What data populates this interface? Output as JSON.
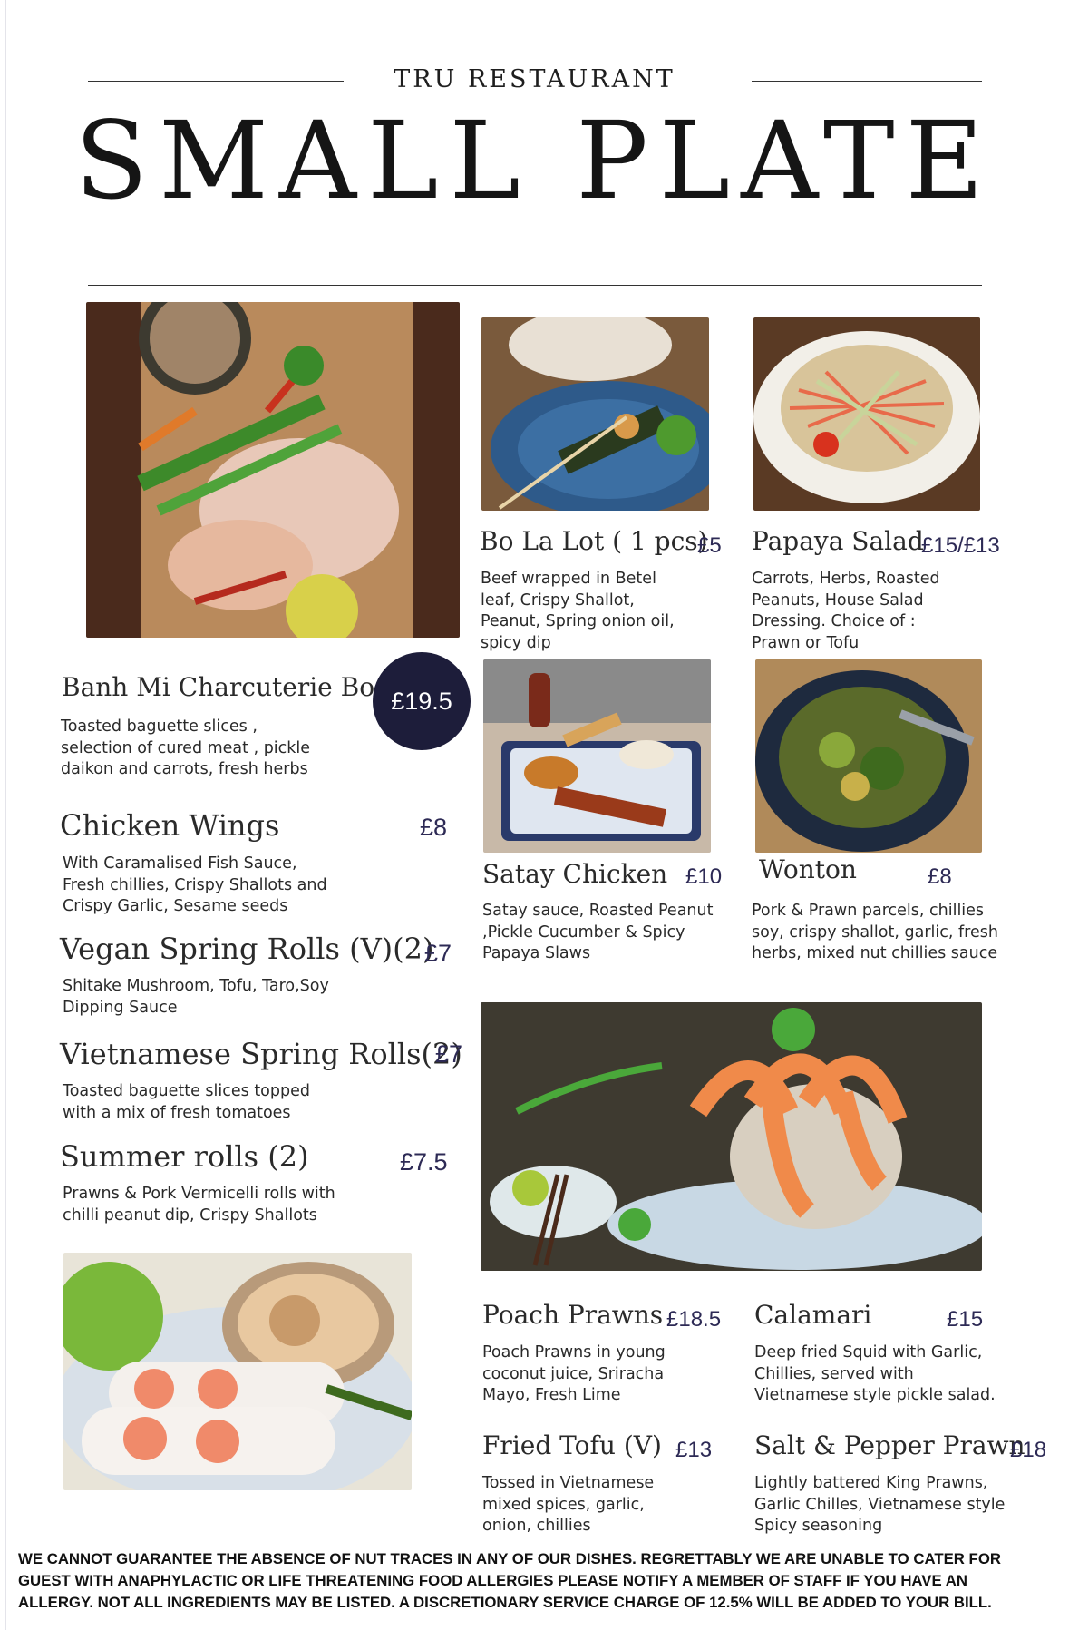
{
  "header": {
    "restaurant": "TRU RESTAURANT",
    "title": "SMALL PLATE"
  },
  "items": {
    "banh_mi": {
      "name": "Banh Mi Charcuterie Board",
      "price": "£19.5",
      "desc": [
        "Toasted baguette slices ,",
        "selection of cured meat , pickle",
        "daikon and carrots,  fresh herbs"
      ]
    },
    "bo_la_lot": {
      "name": "Bo La Lot ( 1 pcs)",
      "price": "£5",
      "desc": [
        "Beef wrapped in Betel",
        "leaf, Crispy Shallot,",
        "Peanut, Spring onion oil,",
        "spicy dip"
      ]
    },
    "papaya_salad": {
      "name": "Papaya Salad",
      "price": "£15/£13",
      "desc": [
        "Carrots, Herbs, Roasted",
        "Peanuts, House Salad",
        "Dressing. Choice of :",
        "Prawn or Tofu"
      ]
    },
    "chicken_wings": {
      "name": "Chicken Wings",
      "price": "£8",
      "desc": [
        "With Caramalised Fish Sauce,",
        "Fresh chillies, Crispy Shallots and",
        "Crispy Garlic, Sesame seeds"
      ]
    },
    "satay_chicken": {
      "name": "Satay Chicken",
      "price": "£10",
      "desc": [
        "Satay sauce, Roasted Peanut",
        ",Pickle Cucumber & Spicy",
        "Papaya Slaws"
      ]
    },
    "wonton": {
      "name": "Wonton",
      "price": "£8",
      "desc": [
        "Pork & Prawn parcels, chillies",
        "soy, crispy shallot, garlic, fresh",
        "herbs, mixed nut chillies sauce"
      ]
    },
    "vegan_spring_rolls": {
      "name": "Vegan Spring Rolls (V)(2)",
      "price": "£7",
      "desc": [
        "Shitake Mushroom, Tofu, Taro,Soy",
        "Dipping Sauce"
      ]
    },
    "vietnamese_spring_rolls": {
      "name": "Vietnamese Spring Rolls(2)",
      "price": "£7",
      "desc": [
        "Toasted baguette slices topped",
        "with a mix of fresh tomatoes"
      ]
    },
    "summer_rolls": {
      "name": "Summer rolls (2)",
      "price": "£7.5",
      "desc": [
        "Prawns & Pork Vermicelli rolls with",
        "chilli peanut dip, Crispy Shallots"
      ]
    },
    "poach_prawns": {
      "name": "Poach Prawns",
      "price": "£18.5",
      "desc": [
        "Poach Prawns in young",
        "coconut juice, Sriracha",
        "Mayo, Fresh Lime"
      ]
    },
    "calamari": {
      "name": "Calamari",
      "price": "£15",
      "desc": [
        "Deep fried Squid with Garlic,",
        "Chillies, served with",
        "Vietnamese style pickle salad."
      ]
    },
    "fried_tofu": {
      "name": "Fried Tofu (V)",
      "price": "£13",
      "desc": [
        "Tossed in Vietnamese",
        "mixed spices, garlic,",
        "onion, chillies"
      ]
    },
    "salt_pepper_prawn": {
      "name": "Salt & Pepper Prawn",
      "price": "£18",
      "desc": [
        "Lightly battered King Prawns,",
        "Garlic Chilles, Vietnamese style",
        "Spicy seasoning"
      ]
    }
  },
  "footer": {
    "disclaimer": [
      "WE CANNOT GUARANTEE THE ABSENCE OF NUT TRACES IN ANY OF OUR DISHES. REGRETTABLY WE ARE UNABLE TO CATER FOR",
      "GUEST WITH ANAPHYLACTIC OR LIFE THREATENING FOOD ALLERGIES PLEASE NOTIFY A MEMBER OF STAFF IF YOU HAVE AN",
      "ALLERGY. NOT ALL INGREDIENTS MAY BE LISTED. A DISCRETIONARY SERVICE CHARGE OF 12.5% WILL BE ADDED TO YOUR BILL."
    ]
  },
  "colors": {
    "price_text": "#2d2a55",
    "price_circle": "#1d1d3a",
    "text": "#2a2a2a"
  }
}
